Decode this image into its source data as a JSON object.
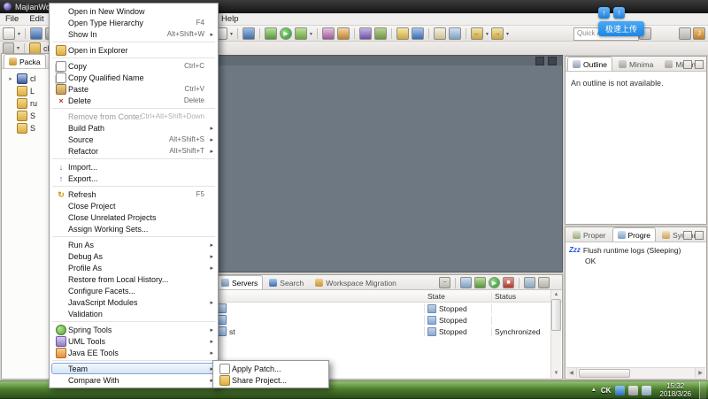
{
  "window": {
    "title": "MajianWork"
  },
  "menubar": {
    "items": [
      "File",
      "Edit",
      "Help"
    ]
  },
  "toolbar": {
    "quick_access_label": "Quick Access",
    "left_icons": [
      "new",
      "caret",
      "sep",
      "save",
      "print"
    ],
    "main_icons": [
      "new-wizard",
      "caret",
      "sep",
      "save",
      "sep",
      "debug",
      "run",
      "run-history",
      "caret",
      "sep",
      "profile",
      "coverage",
      "sep",
      "new-java-project",
      "java-class",
      "sep",
      "open-type",
      "search",
      "sep",
      "bookmark",
      "task",
      "sep",
      "back",
      "caret",
      "forward",
      "caret"
    ],
    "right_icons": [
      "grid"
    ],
    "perspectives": [
      "open-perspective",
      "java-ee-perspective"
    ]
  },
  "overlay": {
    "badge": "极速上传",
    "icons": [
      "cloud-upload",
      "cloud-sync"
    ]
  },
  "explorer": {
    "tab": "Packa",
    "breadcrumb": "clent",
    "items": [
      {
        "label": "cl",
        "icon": "project"
      },
      {
        "label": "L",
        "icon": "folder"
      },
      {
        "label": "ru",
        "icon": "folder"
      },
      {
        "label": "S",
        "icon": "folder"
      },
      {
        "label": "S",
        "icon": "folder"
      }
    ]
  },
  "context_menu": {
    "items": [
      {
        "label": "Open in New Window"
      },
      {
        "label": "Open Type Hierarchy",
        "shortcut": "F4"
      },
      {
        "label": "Show In",
        "shortcut": "Alt+Shift+W",
        "submenu": true
      },
      {
        "sep": true
      },
      {
        "label": "Open in Explorer",
        "icon": "explorer"
      },
      {
        "sep": true
      },
      {
        "label": "Copy",
        "shortcut": "Ctrl+C",
        "icon": "copy"
      },
      {
        "label": "Copy Qualified Name",
        "icon": "copy"
      },
      {
        "label": "Paste",
        "shortcut": "Ctrl+V",
        "icon": "paste"
      },
      {
        "label": "Delete",
        "shortcut": "Delete",
        "icon": "delete"
      },
      {
        "sep": true
      },
      {
        "label": "Remove from Context",
        "shortcut": "Ctrl+Alt+Shift+Down",
        "disabled": true
      },
      {
        "label": "Build Path",
        "submenu": true
      },
      {
        "label": "Source",
        "shortcut": "Alt+Shift+S",
        "submenu": true
      },
      {
        "label": "Refactor",
        "shortcut": "Alt+Shift+T",
        "submenu": true
      },
      {
        "sep": true
      },
      {
        "label": "Import...",
        "icon": "import"
      },
      {
        "label": "Export...",
        "icon": "export"
      },
      {
        "sep": true
      },
      {
        "label": "Refresh",
        "shortcut": "F5",
        "icon": "refresh"
      },
      {
        "label": "Close Project"
      },
      {
        "label": "Close Unrelated Projects"
      },
      {
        "label": "Assign Working Sets..."
      },
      {
        "sep": true
      },
      {
        "label": "Run As",
        "submenu": true
      },
      {
        "label": "Debug As",
        "submenu": true
      },
      {
        "label": "Profile As",
        "submenu": true
      },
      {
        "label": "Restore from Local History..."
      },
      {
        "label": "Configure Facets..."
      },
      {
        "label": "JavaScript Modules",
        "submenu": true
      },
      {
        "label": "Validation"
      },
      {
        "sep": true
      },
      {
        "label": "Spring Tools",
        "submenu": true,
        "icon": "spring"
      },
      {
        "label": "UML Tools",
        "submenu": true,
        "icon": "uml"
      },
      {
        "label": "Java EE Tools",
        "submenu": true,
        "icon": "jee"
      },
      {
        "sep": true
      },
      {
        "label": "Team",
        "submenu": true,
        "highlight": true
      },
      {
        "label": "Compare With",
        "submenu": true
      }
    ]
  },
  "team_submenu": {
    "items": [
      {
        "label": "Apply Patch...",
        "icon": "patch"
      },
      {
        "label": "Share Project...",
        "icon": "share"
      }
    ]
  },
  "servers": {
    "tabs": [
      {
        "label": "Servers",
        "icon": "server",
        "active": true
      },
      {
        "label": "Search",
        "icon": "search"
      },
      {
        "label": "Workspace Migration",
        "icon": "workspace"
      }
    ],
    "toolbar_icons": [
      "collapse-all",
      "sep",
      "new-server",
      "debug-server",
      "start-server",
      "stop-server",
      "sep",
      "publish",
      "clean"
    ],
    "columns": {
      "state": "State",
      "status": "Status"
    },
    "rows": [
      {
        "name": "",
        "state": "Stopped",
        "status": ""
      },
      {
        "name": "",
        "state": "Stopped",
        "status": ""
      },
      {
        "name": "st",
        "state": "Stopped",
        "status": "Synchronized"
      }
    ]
  },
  "outline": {
    "tabs": [
      {
        "label": "Outline",
        "icon": "outline",
        "active": true
      },
      {
        "label": "Minima",
        "icon": "minimap"
      },
      {
        "label": "Minima",
        "icon": "minimap"
      }
    ],
    "message": "An outline is not available."
  },
  "progress": {
    "tabs": [
      {
        "label": "Proper",
        "icon": "properties"
      },
      {
        "label": "Progre",
        "icon": "progress",
        "active": true
      },
      {
        "label": "Synchr",
        "icon": "synchronize"
      }
    ],
    "sleep_icon": "Zzz",
    "line1": "Flush runtime logs (Sleeping)",
    "line2": "OK"
  },
  "taskbar": {
    "tray_expand": "▲",
    "lang": "CK",
    "tray_icons": [
      "ime",
      "volume",
      "network"
    ],
    "time": "15:32",
    "date": "2018/3/26"
  }
}
